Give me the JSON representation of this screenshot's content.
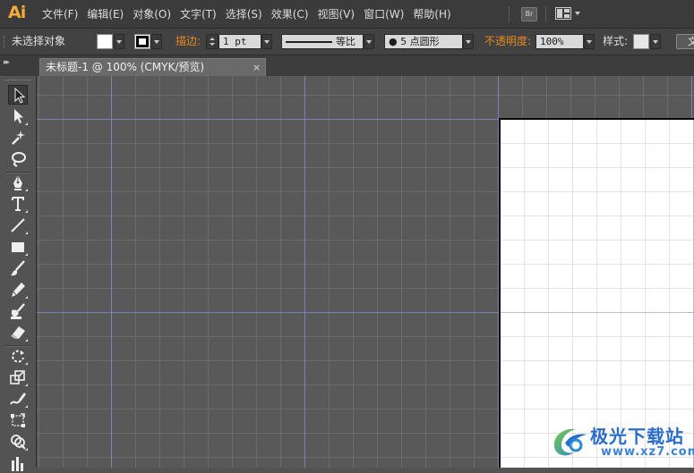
{
  "app": {
    "logo": "Ai"
  },
  "menubar": {
    "items": [
      {
        "label": "文件(F)"
      },
      {
        "label": "编辑(E)"
      },
      {
        "label": "对象(O)"
      },
      {
        "label": "文字(T)"
      },
      {
        "label": "选择(S)"
      },
      {
        "label": "效果(C)"
      },
      {
        "label": "视图(V)"
      },
      {
        "label": "窗口(W)"
      },
      {
        "label": "帮助(H)"
      }
    ],
    "bridge_label": "Br"
  },
  "controlbar": {
    "selection_label": "未选择对象",
    "stroke_label": "描边:",
    "stroke_weight": "1 pt",
    "stroke_profile": "等比",
    "brush_value": "●  5 点圆形",
    "opacity_label": "不透明度:",
    "opacity_value": "100%",
    "style_label": "样式:",
    "doc_setup_label": "文"
  },
  "document": {
    "tab_title": "未标题-1 @ 100% (CMYK/预览)",
    "close_symbol": "×"
  },
  "tools": [
    {
      "name": "selection-tool-icon"
    },
    {
      "name": "direct-selection-tool-icon"
    },
    {
      "name": "magic-wand-tool-icon"
    },
    {
      "name": "lasso-tool-icon"
    },
    {
      "name": "pen-tool-icon"
    },
    {
      "name": "type-tool-icon"
    },
    {
      "name": "line-tool-icon"
    },
    {
      "name": "rectangle-tool-icon"
    },
    {
      "name": "paintbrush-tool-icon"
    },
    {
      "name": "pencil-tool-icon"
    },
    {
      "name": "blob-brush-tool-icon"
    },
    {
      "name": "eraser-tool-icon"
    },
    {
      "name": "rotate-tool-icon"
    },
    {
      "name": "scale-tool-icon"
    },
    {
      "name": "warp-tool-icon"
    },
    {
      "name": "free-transform-tool-icon"
    },
    {
      "name": "shape-builder-tool-icon"
    },
    {
      "name": "graph-tool-icon"
    }
  ],
  "watermark": {
    "title": "极光下载站",
    "url": "www.xz7.com"
  },
  "colors": {
    "menubar_bg": "#3b3b3b",
    "controlbar_bg": "#424242",
    "canvas_bg": "#595959",
    "accent_orange": "#e8891e",
    "grid_major": "#7c82b5",
    "artboard": "#ffffff"
  }
}
